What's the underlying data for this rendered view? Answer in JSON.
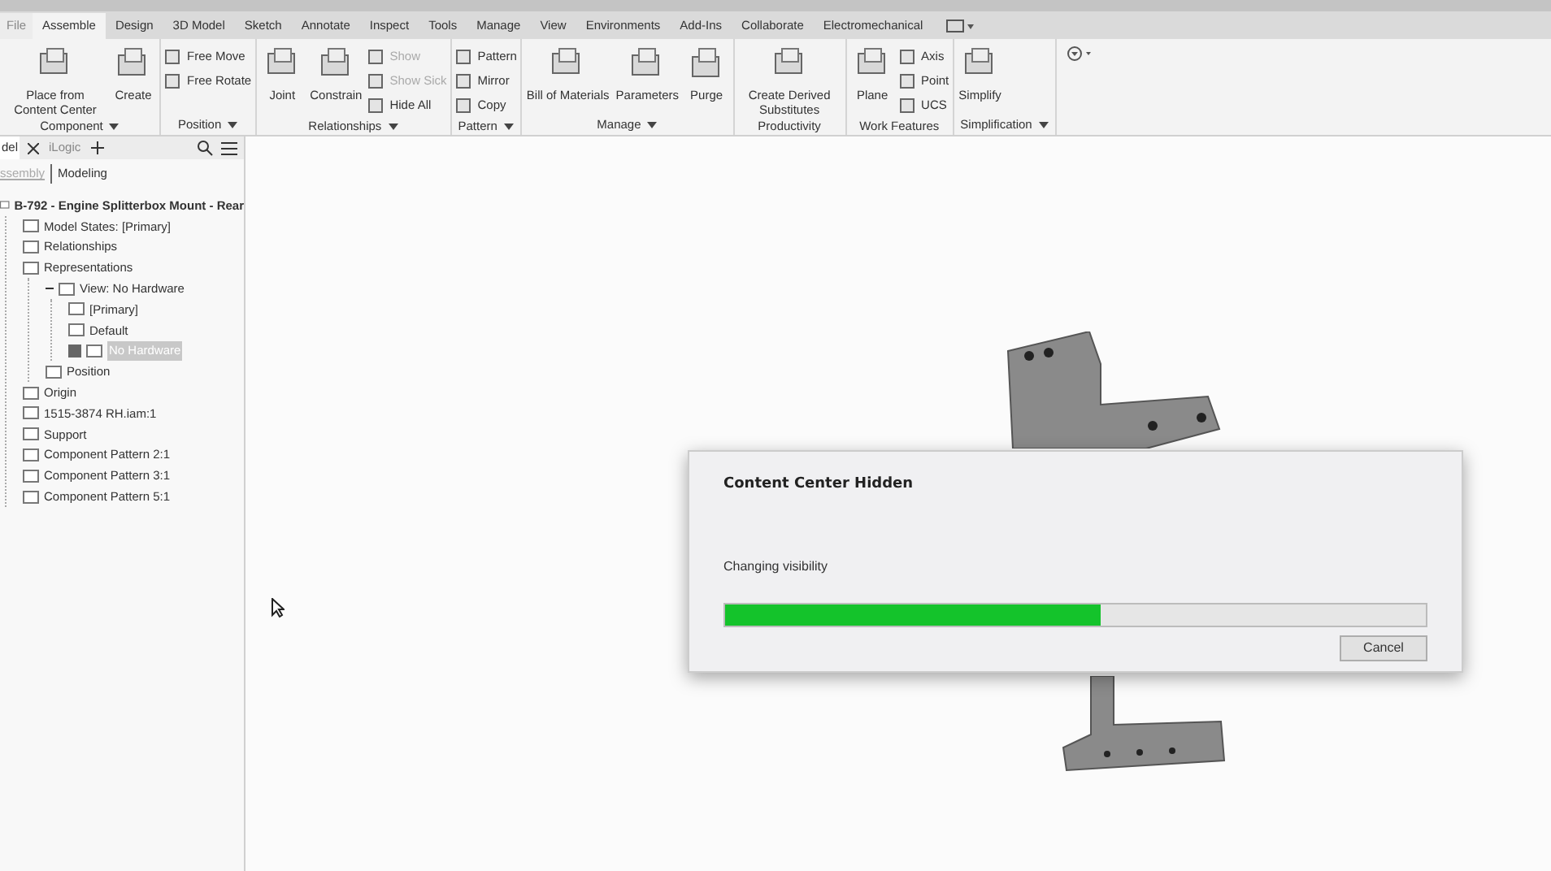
{
  "file_tab": "File",
  "tabs": [
    {
      "label": "Assemble",
      "selected": true
    },
    {
      "label": "Design",
      "selected": false
    },
    {
      "label": "3D Model",
      "selected": false
    },
    {
      "label": "Sketch",
      "selected": false
    },
    {
      "label": "Annotate",
      "selected": false
    },
    {
      "label": "Inspect",
      "selected": false
    },
    {
      "label": "Tools",
      "selected": false
    },
    {
      "label": "Manage",
      "selected": false
    },
    {
      "label": "View",
      "selected": false
    },
    {
      "label": "Environments",
      "selected": false
    },
    {
      "label": "Add-Ins",
      "selected": false
    },
    {
      "label": "Collaborate",
      "selected": false
    },
    {
      "label": "Electromechanical",
      "selected": false
    }
  ],
  "ribbon": {
    "panels": [
      {
        "label": "Component",
        "menu": true,
        "items": [
          {
            "kind": "large",
            "label": "Place from Content Center",
            "disabled": false
          },
          {
            "kind": "large",
            "label": "Create",
            "disabled": false
          }
        ]
      },
      {
        "label": "Position",
        "menu": true,
        "items": [
          {
            "kind": "small",
            "label": "Free Move",
            "disabled": false
          },
          {
            "kind": "small",
            "label": "Free Rotate",
            "disabled": false
          }
        ]
      },
      {
        "label": "Relationships",
        "menu": true,
        "items": [
          {
            "kind": "large",
            "label": "Joint",
            "disabled": false
          },
          {
            "kind": "large",
            "label": "Constrain",
            "disabled": false
          },
          {
            "kind": "small",
            "label": "Show",
            "disabled": true
          },
          {
            "kind": "small",
            "label": "Show Sick",
            "disabled": true
          },
          {
            "kind": "small",
            "label": "Hide All",
            "disabled": false
          }
        ]
      },
      {
        "label": "Pattern",
        "menu": true,
        "items": [
          {
            "kind": "small",
            "label": "Pattern",
            "disabled": false
          },
          {
            "kind": "small",
            "label": "Mirror",
            "disabled": false
          },
          {
            "kind": "small",
            "label": "Copy",
            "disabled": false
          }
        ]
      },
      {
        "label": "Manage",
        "menu": true,
        "items": [
          {
            "kind": "large",
            "label": "Bill of Materials",
            "disabled": false
          },
          {
            "kind": "large",
            "label": "Parameters",
            "disabled": false
          },
          {
            "kind": "large",
            "label": "Purge",
            "disabled": false
          }
        ]
      },
      {
        "label": "Productivity",
        "menu": false,
        "items": [
          {
            "kind": "large",
            "label": "Create Derived Substitutes",
            "disabled": false
          }
        ]
      },
      {
        "label": "Work Features",
        "menu": false,
        "items": [
          {
            "kind": "large",
            "label": "Plane",
            "disabled": false
          },
          {
            "kind": "small",
            "label": "Axis",
            "disabled": false
          },
          {
            "kind": "small",
            "label": "Point",
            "disabled": false
          },
          {
            "kind": "small",
            "label": "UCS",
            "disabled": false
          }
        ]
      },
      {
        "label": "Simplification",
        "menu": true,
        "items": [
          {
            "kind": "large",
            "label": "Simplify",
            "disabled": false
          }
        ]
      }
    ]
  },
  "browser": {
    "tabs": [
      {
        "label": "del",
        "selected": true
      },
      {
        "label": "iLogic",
        "selected": false
      }
    ],
    "modes": [
      {
        "label": "ssembly",
        "selected": false
      },
      {
        "label": "Modeling",
        "selected": true
      }
    ],
    "tree": [
      {
        "label": "B-792 - Engine Splitterbox Mount - Rear",
        "selected": false,
        "children": [
          {
            "label": "Model States: [Primary]",
            "selected": false
          },
          {
            "label": "Relationships",
            "selected": false
          },
          {
            "label": "Representations",
            "selected": false,
            "children": [
              {
                "label": "View: No Hardware",
                "expanded": true,
                "selected": false,
                "children": [
                  {
                    "label": "[Primary]",
                    "selected": false
                  },
                  {
                    "label": "Default",
                    "selected": false
                  },
                  {
                    "label": "No Hardware",
                    "checked": true,
                    "selected": true
                  }
                ]
              },
              {
                "label": "Position",
                "selected": false
              }
            ]
          },
          {
            "label": "Origin",
            "selected": false
          },
          {
            "label": "1515-3874 RH.iam:1",
            "selected": false
          },
          {
            "label": "Support",
            "selected": false
          },
          {
            "label": "Component Pattern 2:1",
            "selected": false
          },
          {
            "label": "Component Pattern 3:1",
            "selected": false
          },
          {
            "label": "Component Pattern 5:1",
            "selected": false
          }
        ]
      }
    ]
  },
  "dialog": {
    "title": "Content Center Hidden",
    "message": "Changing visibility",
    "progress": {
      "level": 0.535
    },
    "button": "Cancel"
  }
}
